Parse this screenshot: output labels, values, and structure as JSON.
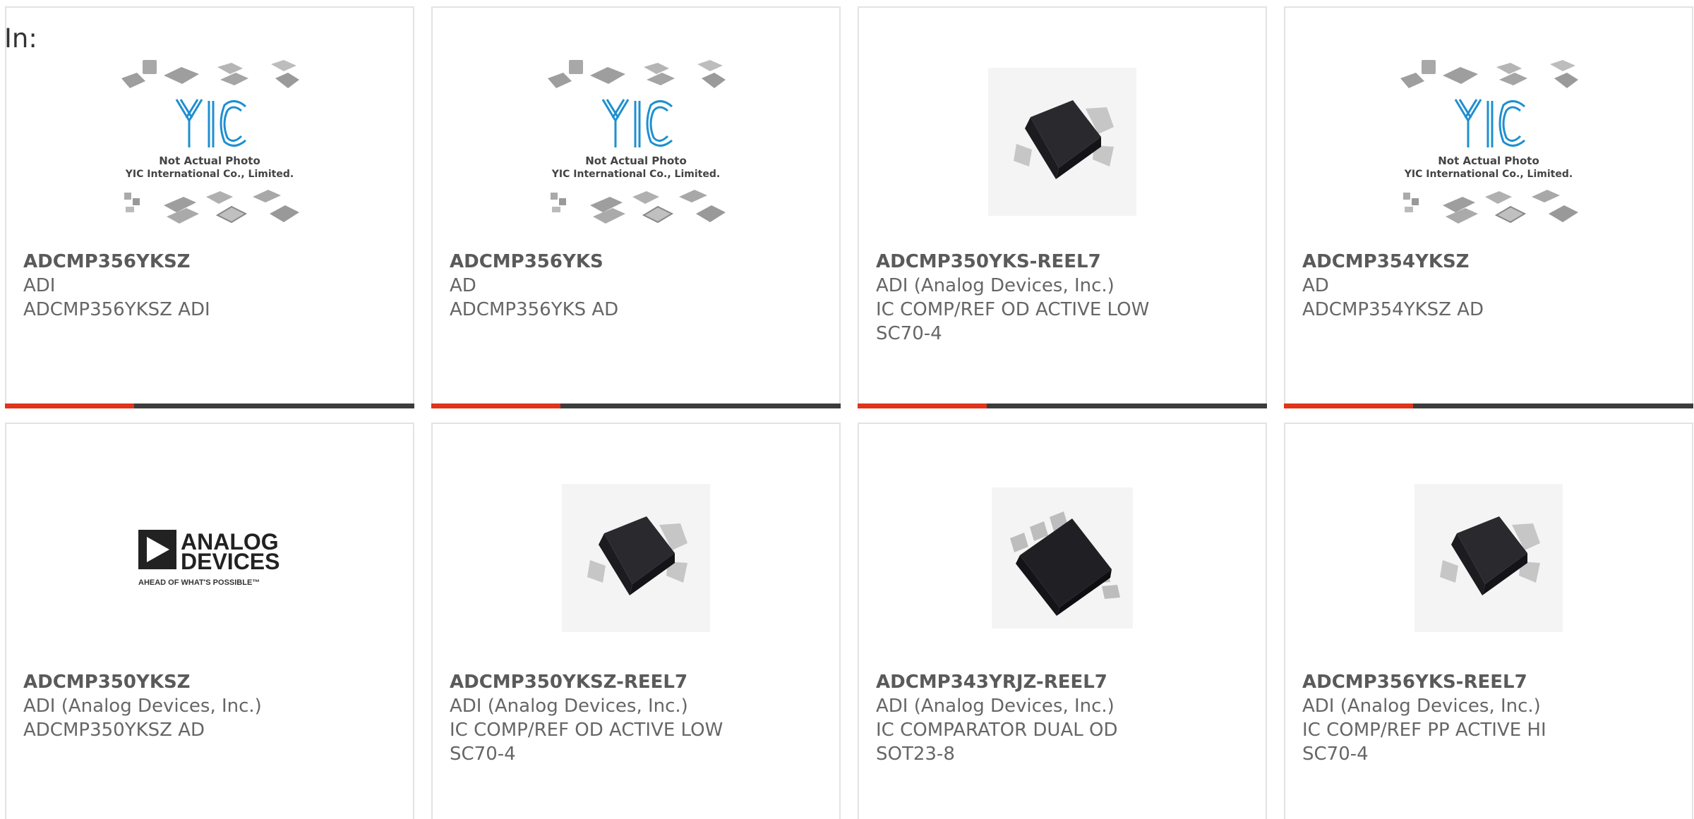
{
  "header": {
    "in_label": "In:"
  },
  "images": {
    "placeholder_line1": "Not Actual Photo",
    "placeholder_line2": "YIC International Co., Limited.",
    "adi_logo_line1": "ANALOG",
    "adi_logo_line2": "DEVICES",
    "adi_tagline": "AHEAD OF WHAT'S POSSIBLE™"
  },
  "colors": {
    "accent": "#e0341b",
    "bar": "#3c3c3c",
    "yic_blue": "#1e8fd0"
  },
  "products": [
    {
      "part": "ADCMP356YKSZ",
      "maker": "ADI",
      "desc": "ADCMP356YKSZ ADI",
      "image": "yic-placeholder"
    },
    {
      "part": "ADCMP356YKS",
      "maker": "AD",
      "desc": "ADCMP356YKS AD",
      "image": "yic-placeholder"
    },
    {
      "part": "ADCMP350YKS-REEL7",
      "maker": "ADI (Analog Devices, Inc.)",
      "desc": "IC COMP/REF OD ACTIVE LOW\nSC70-4",
      "image": "sc70-chip"
    },
    {
      "part": "ADCMP354YKSZ",
      "maker": "AD",
      "desc": "ADCMP354YKSZ AD",
      "image": "yic-placeholder"
    },
    {
      "part": "ADCMP350YKSZ",
      "maker": "ADI (Analog Devices, Inc.)",
      "desc": "ADCMP350YKSZ AD",
      "image": "adi-logo"
    },
    {
      "part": "ADCMP350YKSZ-REEL7",
      "maker": "ADI (Analog Devices, Inc.)",
      "desc": "IC COMP/REF OD ACTIVE LOW\nSC70-4",
      "image": "sc70-chip"
    },
    {
      "part": "ADCMP343YRJZ-REEL7",
      "maker": "ADI (Analog Devices, Inc.)",
      "desc": "IC COMPARATOR DUAL OD\nSOT23-8",
      "image": "sot23-chip"
    },
    {
      "part": "ADCMP356YKS-REEL7",
      "maker": "ADI (Analog Devices, Inc.)",
      "desc": "IC COMP/REF PP ACTIVE HI\nSC70-4",
      "image": "sc70-chip"
    }
  ]
}
